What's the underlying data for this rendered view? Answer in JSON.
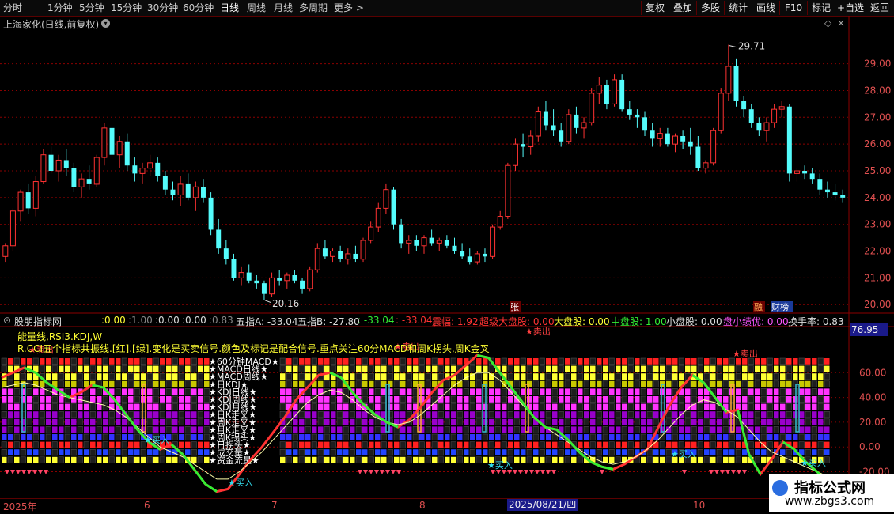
{
  "toolbar": {
    "timeframes": [
      "分时",
      "1分钟",
      "5分钟",
      "15分钟",
      "30分钟",
      "60分钟",
      "日线",
      "周线",
      "月线",
      "多周期",
      "更多 >"
    ],
    "active_timeframe": "日线",
    "buttons": [
      "复权",
      "叠加",
      "多股",
      "统计",
      "画线",
      "F10",
      "标记",
      "+自选",
      "返回"
    ]
  },
  "stock": {
    "title": "上海家化(日线,前复权)"
  },
  "price_axis": {
    "labels": [
      "29.00",
      "28.00",
      "27.00",
      "26.00",
      "25.00",
      "24.00",
      "23.00",
      "22.00",
      "21.00",
      "20.00"
    ]
  },
  "annotations": {
    "high": "29.71",
    "low": "20.16",
    "zhang": "张",
    "rong": "融",
    "caibang": "财榜"
  },
  "indicator": {
    "name": "股朋指标网",
    "header_values": [
      ":0.00",
      ":1.00",
      ":0.00",
      ":0.00",
      ":0.83",
      "五指A: -33.04",
      "五指B: -27.80",
      ": -33.04",
      ": -33.04",
      "震幅: 1.92",
      "超级大盘股: 0.00",
      "大盘股: 0.00",
      "中盘股: 1.00",
      "小盘股: 0.00",
      "盘小绩优: 0.00",
      "换手率: 0.83"
    ],
    "current_value": "76.95",
    "desc_line1": "能量线,RSI3.KDJ,W",
    "desc_line2": "R.CCI五个指标共振线.[红].[绿].变化是买卖信号.颜色及标记是配合信号.重点关注60分MACD和周K拐头,周K金叉",
    "axis_labels": [
      "60.00",
      "40.00",
      "20.00",
      "0.00",
      "-20.00"
    ],
    "row_labels": [
      "★60分钟MACD★",
      "★MACD日线★",
      "★MACD周线★",
      "★日KDJ★",
      "★KDJ日线★",
      "★KDJ周线★",
      "★KDJ月线★",
      "★日K走叉★",
      "★周K走叉★",
      "★月K走叉★",
      "★周K拐头★",
      "★日拐头★",
      "★成交量★",
      "★资金流量★"
    ],
    "buy_label": "买入",
    "sell_label": "卖出"
  },
  "dates": {
    "labels": [
      "2025年",
      "6",
      "7",
      "8",
      "9",
      "10"
    ],
    "current": "2025/08/21/四"
  },
  "watermark": {
    "title": "指标公式网",
    "url": "www.zbgs3.com"
  },
  "colors": {
    "up": "#ff3232",
    "down": "#54fcfc",
    "grid": "#8b0000",
    "yellow": "#ffff33",
    "green": "#33ee33"
  },
  "chart_data": {
    "type": "candlestick",
    "title": "上海家化(日线,前复权)",
    "ylim": [
      19.8,
      30.2
    ],
    "ohlc": [
      [
        21.8,
        22.3,
        21.6,
        22.2
      ],
      [
        22.2,
        23.6,
        22.0,
        23.5
      ],
      [
        23.5,
        24.3,
        23.1,
        24.2
      ],
      [
        24.2,
        24.5,
        23.4,
        23.6
      ],
      [
        23.6,
        24.8,
        23.3,
        24.6
      ],
      [
        24.6,
        25.8,
        24.5,
        25.6
      ],
      [
        25.6,
        25.9,
        24.9,
        25.0
      ],
      [
        25.0,
        25.6,
        24.6,
        25.4
      ],
      [
        25.4,
        25.8,
        24.8,
        25.1
      ],
      [
        25.1,
        25.3,
        24.2,
        24.4
      ],
      [
        24.4,
        24.9,
        24.0,
        24.7
      ],
      [
        24.7,
        25.2,
        24.3,
        24.5
      ],
      [
        24.5,
        25.6,
        24.4,
        25.5
      ],
      [
        25.5,
        26.8,
        25.2,
        26.6
      ],
      [
        26.6,
        26.9,
        25.4,
        25.6
      ],
      [
        25.6,
        26.3,
        25.1,
        26.1
      ],
      [
        26.1,
        26.4,
        25.0,
        25.2
      ],
      [
        25.2,
        25.5,
        24.6,
        24.9
      ],
      [
        24.9,
        25.3,
        24.5,
        25.1
      ],
      [
        25.1,
        25.6,
        24.8,
        25.3
      ],
      [
        25.3,
        25.5,
        24.6,
        24.8
      ],
      [
        24.8,
        25.0,
        24.1,
        24.3
      ],
      [
        24.3,
        24.6,
        23.9,
        24.1
      ],
      [
        24.1,
        24.8,
        23.7,
        24.5
      ],
      [
        24.5,
        24.9,
        23.9,
        24.0
      ],
      [
        24.0,
        24.6,
        23.5,
        24.4
      ],
      [
        24.4,
        24.7,
        23.8,
        24.0
      ],
      [
        24.0,
        24.2,
        22.6,
        22.8
      ],
      [
        22.8,
        23.2,
        21.9,
        22.1
      ],
      [
        22.1,
        22.4,
        21.5,
        21.7
      ],
      [
        21.7,
        21.9,
        20.9,
        21.0
      ],
      [
        21.0,
        21.4,
        20.7,
        21.2
      ],
      [
        21.2,
        21.5,
        20.8,
        20.9
      ],
      [
        20.9,
        21.1,
        20.6,
        20.8
      ],
      [
        20.8,
        20.9,
        20.16,
        20.4
      ],
      [
        20.4,
        21.2,
        20.3,
        21.0
      ],
      [
        21.0,
        21.3,
        20.7,
        20.9
      ],
      [
        20.9,
        21.2,
        20.6,
        21.1
      ],
      [
        21.1,
        21.3,
        20.8,
        20.9
      ],
      [
        20.9,
        21.0,
        20.4,
        20.6
      ],
      [
        20.6,
        21.4,
        20.5,
        21.3
      ],
      [
        21.3,
        22.3,
        21.2,
        22.1
      ],
      [
        22.1,
        22.4,
        21.7,
        21.8
      ],
      [
        21.8,
        22.1,
        21.6,
        22.0
      ],
      [
        22.0,
        22.2,
        21.6,
        21.7
      ],
      [
        21.7,
        22.1,
        21.5,
        21.9
      ],
      [
        21.9,
        22.2,
        21.6,
        21.7
      ],
      [
        21.7,
        22.5,
        21.6,
        22.4
      ],
      [
        22.4,
        23.1,
        22.3,
        22.9
      ],
      [
        22.9,
        23.8,
        22.7,
        23.6
      ],
      [
        23.6,
        24.5,
        23.4,
        24.3
      ],
      [
        24.3,
        24.4,
        22.8,
        23.0
      ],
      [
        23.0,
        23.2,
        22.1,
        22.3
      ],
      [
        22.3,
        22.6,
        21.9,
        22.4
      ],
      [
        22.4,
        22.6,
        22.0,
        22.2
      ],
      [
        22.2,
        22.6,
        21.9,
        22.5
      ],
      [
        22.5,
        22.8,
        22.2,
        22.3
      ],
      [
        22.3,
        22.5,
        22.0,
        22.4
      ],
      [
        22.4,
        22.6,
        22.1,
        22.2
      ],
      [
        22.2,
        22.5,
        21.9,
        22.0
      ],
      [
        22.0,
        22.3,
        21.7,
        21.8
      ],
      [
        21.8,
        22.1,
        21.5,
        21.6
      ],
      [
        21.6,
        22.0,
        21.5,
        21.9
      ],
      [
        21.9,
        22.1,
        21.6,
        21.8
      ],
      [
        21.8,
        23.0,
        21.7,
        22.9
      ],
      [
        22.9,
        23.5,
        22.8,
        23.3
      ],
      [
        23.3,
        25.3,
        23.2,
        25.2
      ],
      [
        25.2,
        26.2,
        25.0,
        26.0
      ],
      [
        26.0,
        26.4,
        25.5,
        25.9
      ],
      [
        25.9,
        26.5,
        25.6,
        26.3
      ],
      [
        26.3,
        27.4,
        26.1,
        27.2
      ],
      [
        27.2,
        27.6,
        26.5,
        26.7
      ],
      [
        26.7,
        27.3,
        26.3,
        26.5
      ],
      [
        26.5,
        26.8,
        25.9,
        26.1
      ],
      [
        26.1,
        27.3,
        26.0,
        27.1
      ],
      [
        27.1,
        27.4,
        26.4,
        26.6
      ],
      [
        26.6,
        27.0,
        26.2,
        26.8
      ],
      [
        26.8,
        28.1,
        26.7,
        27.9
      ],
      [
        27.9,
        28.5,
        27.5,
        28.2
      ],
      [
        28.2,
        28.4,
        27.3,
        27.5
      ],
      [
        27.5,
        28.6,
        27.4,
        28.4
      ],
      [
        28.4,
        28.6,
        27.2,
        27.3
      ],
      [
        27.3,
        27.6,
        26.9,
        27.1
      ],
      [
        27.1,
        27.3,
        26.6,
        27.0
      ],
      [
        27.0,
        27.2,
        26.3,
        26.5
      ],
      [
        26.5,
        26.8,
        25.9,
        26.2
      ],
      [
        26.2,
        26.6,
        25.9,
        26.4
      ],
      [
        26.4,
        26.6,
        25.9,
        26.0
      ],
      [
        26.0,
        26.4,
        25.7,
        26.3
      ],
      [
        26.3,
        26.5,
        25.8,
        26.1
      ],
      [
        26.1,
        26.6,
        25.6,
        25.9
      ],
      [
        25.9,
        26.3,
        25.0,
        25.1
      ],
      [
        25.1,
        25.4,
        24.9,
        25.3
      ],
      [
        25.3,
        26.6,
        25.2,
        26.5
      ],
      [
        26.5,
        28.1,
        26.4,
        27.9
      ],
      [
        27.9,
        29.71,
        27.6,
        28.9
      ],
      [
        28.9,
        29.2,
        27.4,
        27.6
      ],
      [
        27.6,
        27.8,
        27.0,
        27.3
      ],
      [
        27.3,
        27.5,
        26.6,
        26.8
      ],
      [
        26.8,
        27.0,
        26.3,
        26.5
      ],
      [
        26.5,
        27.0,
        26.1,
        26.8
      ],
      [
        26.8,
        27.5,
        26.6,
        27.3
      ],
      [
        27.3,
        27.6,
        27.0,
        27.4
      ],
      [
        27.4,
        27.5,
        24.6,
        24.9
      ],
      [
        24.9,
        25.1,
        24.6,
        25.0
      ],
      [
        25.0,
        25.2,
        24.7,
        24.9
      ],
      [
        24.9,
        25.1,
        24.5,
        24.7
      ],
      [
        24.7,
        24.9,
        24.1,
        24.3
      ],
      [
        24.3,
        24.6,
        24.0,
        24.2
      ],
      [
        24.2,
        24.5,
        23.9,
        24.1
      ],
      [
        24.1,
        24.3,
        23.8,
        24.0
      ]
    ],
    "indicator_series": [
      {
        "name": "",
        "color": "#ff3232",
        "values": [
          56,
          60,
          64,
          60,
          52,
          46,
          40,
          44,
          50,
          48,
          38,
          26,
          14,
          4,
          -2,
          2,
          -6,
          -18,
          -30,
          -36,
          -34,
          -22,
          -10,
          0,
          12,
          24,
          38,
          48,
          58,
          60,
          56,
          44,
          34,
          26,
          20,
          16,
          22,
          32,
          44,
          54,
          58,
          66,
          74,
          72,
          60,
          48,
          36,
          24,
          16,
          14,
          6,
          -4,
          -12,
          -16,
          -18,
          -14,
          -8,
          -2,
          16,
          34,
          48,
          58,
          52,
          40,
          28,
          30,
          -6,
          -22,
          -10,
          4,
          -2,
          -12,
          -20,
          -28
        ]
      },
      {
        "name": "",
        "color": "#ffffaa",
        "values": [
          48,
          50,
          52,
          50,
          46,
          42,
          40,
          38,
          36,
          34,
          30,
          24,
          16,
          8,
          0,
          -4,
          -8,
          -14,
          -20,
          -26,
          -26,
          -20,
          -12,
          -4,
          6,
          16,
          26,
          36,
          42,
          46,
          44,
          38,
          30,
          24,
          20,
          18,
          20,
          26,
          34,
          42,
          50,
          56,
          60,
          60,
          54,
          44,
          34,
          24,
          16,
          10,
          4,
          -2,
          -8,
          -12,
          -14,
          -12,
          -8,
          -2,
          6,
          16,
          26,
          34,
          38,
          36,
          30,
          24,
          14,
          4,
          -4,
          -8,
          -12,
          -16,
          -20,
          -24
        ]
      }
    ]
  }
}
